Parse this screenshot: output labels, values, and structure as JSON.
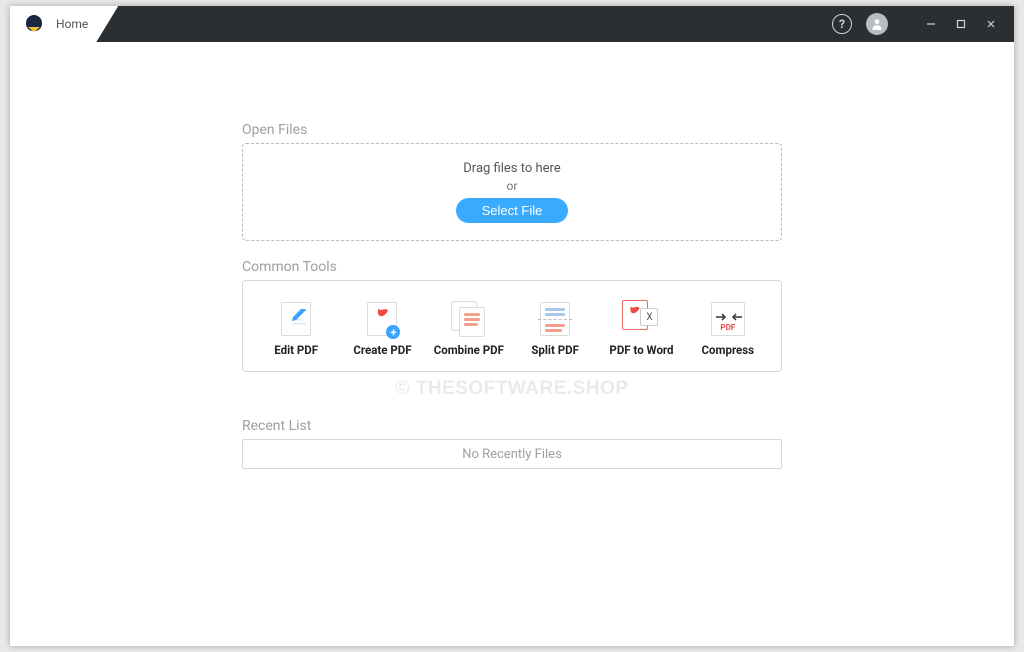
{
  "tab": {
    "label": "Home"
  },
  "open_files": {
    "title": "Open Files",
    "drag_text": "Drag files to here",
    "or_text": "or",
    "select_button": "Select File"
  },
  "common_tools": {
    "title": "Common Tools",
    "items": [
      {
        "label": "Edit PDF",
        "icon": "edit-pdf-icon"
      },
      {
        "label": "Create PDF",
        "icon": "create-pdf-icon"
      },
      {
        "label": "Combine PDF",
        "icon": "combine-pdf-icon"
      },
      {
        "label": "Split PDF",
        "icon": "split-pdf-icon"
      },
      {
        "label": "PDF to Word",
        "icon": "pdf-to-word-icon"
      },
      {
        "label": "Compress",
        "icon": "compress-icon"
      }
    ]
  },
  "recent": {
    "title": "Recent List",
    "empty_text": "No Recently Files"
  },
  "watermark": "© THESOFTWARE.SHOP"
}
